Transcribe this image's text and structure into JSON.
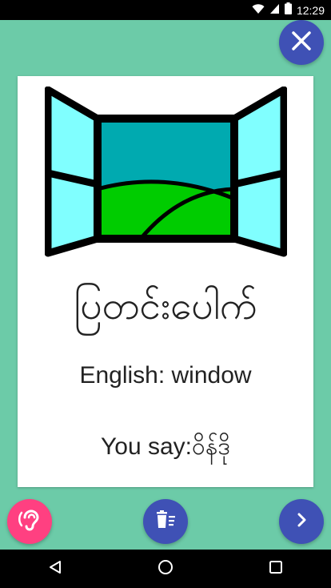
{
  "status_bar": {
    "time": "12:29",
    "wifi_icon": "wifi-icon",
    "signal_icon": "cell-signal-icon",
    "battery_icon": "battery-icon"
  },
  "card": {
    "image_icon": "window-illustration",
    "native_word": "ပြတင်းပေါက်",
    "english_line": "English: window",
    "you_say_line": "You say:ဝိန်ဒို"
  },
  "actions": {
    "close_icon": "close-icon",
    "listen_icon": "ear-icon",
    "delete_icon": "delete-list-icon",
    "next_icon": "chevron-right-icon"
  },
  "nav": {
    "back_icon": "back-triangle-icon",
    "home_icon": "home-circle-icon",
    "recents_icon": "recents-square-icon"
  },
  "colors": {
    "background": "#6ccba8",
    "primary_fab": "#3f51b5",
    "accent_fab": "#ff4081",
    "card": "#ffffff",
    "text": "#222222"
  }
}
